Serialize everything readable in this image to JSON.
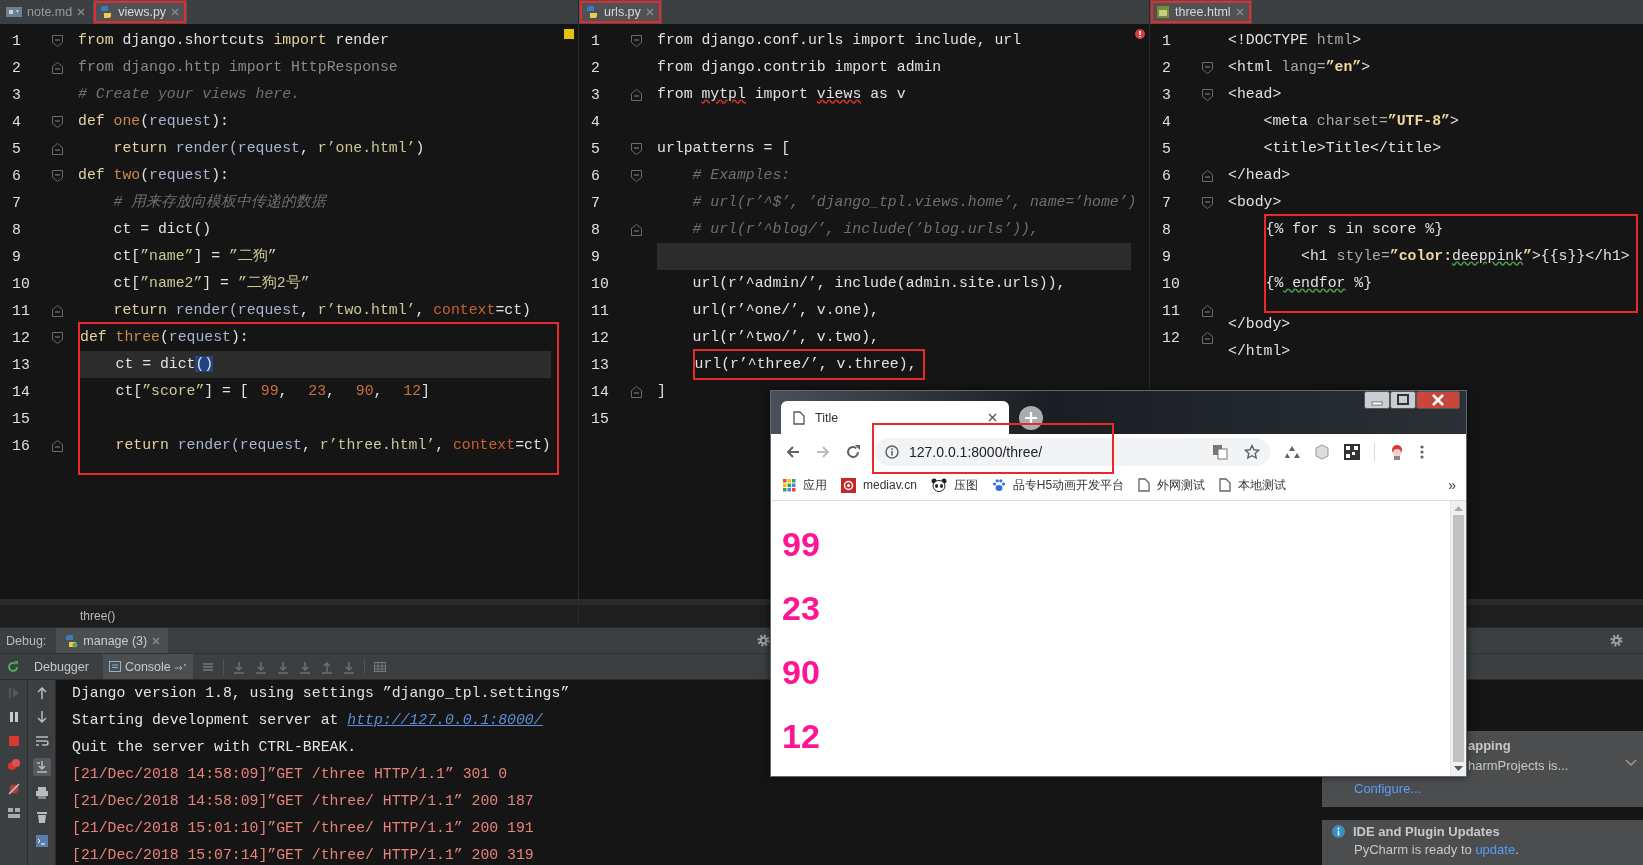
{
  "panes": [
    {
      "marker": {
        "kind": "warning"
      },
      "breadcrumb": "three()",
      "tabs": [
        {
          "label": "note.md",
          "kind": "md",
          "selected": false,
          "boxed": false
        },
        {
          "label": "views.py",
          "kind": "py",
          "selected": true,
          "boxed": true
        }
      ],
      "lines": [
        {
          "n": "1",
          "kind": "fold_start",
          "boxed": false,
          "current": false,
          "tokens": [
            {
              "kind": "kw",
              "text": "from"
            },
            {
              "kind": "txt",
              "text": " django.shortcuts "
            },
            {
              "kind": "kw",
              "text": "import"
            },
            {
              "kind": "txt",
              "text": " render"
            }
          ]
        },
        {
          "n": "2",
          "kind": "fold_end",
          "boxed": false,
          "current": false,
          "tokens": [
            {
              "kind": "dim",
              "text": "from django.http import HttpResponse"
            }
          ]
        },
        {
          "n": "3",
          "kind": "plain",
          "boxed": false,
          "current": false,
          "tokens": [
            {
              "kind": "com",
              "text": "# Create your views here."
            }
          ]
        },
        {
          "n": "4",
          "kind": "fold_start",
          "boxed": false,
          "current": false,
          "tokens": [
            {
              "kind": "kw",
              "text": "def"
            },
            {
              "kind": "name",
              "text": " one"
            },
            {
              "kind": "txt",
              "text": "("
            },
            {
              "kind": "param",
              "text": "request"
            },
            {
              "kind": "txt",
              "text": "):"
            }
          ]
        },
        {
          "n": "5",
          "kind": "fold_end",
          "boxed": false,
          "current": false,
          "tokens": [
            {
              "kind": "kw",
              "text": "    return"
            },
            {
              "kind": "param",
              "text": " render(request"
            },
            {
              "kind": "txt",
              "text": ", "
            },
            {
              "kind": "str",
              "text": "r’one.html’"
            },
            {
              "kind": "txt",
              "text": ")"
            }
          ]
        },
        {
          "n": "6",
          "kind": "fold_start",
          "boxed": false,
          "current": false,
          "tokens": [
            {
              "kind": "kw",
              "text": "def"
            },
            {
              "kind": "name",
              "text": " two"
            },
            {
              "kind": "txt",
              "text": "("
            },
            {
              "kind": "param",
              "text": "request"
            },
            {
              "kind": "txt",
              "text": "):"
            }
          ]
        },
        {
          "n": "7",
          "kind": "plain",
          "boxed": false,
          "current": false,
          "tokens": [
            {
              "kind": "com",
              "text": "    # 用来存放向模板中传递的数据"
            }
          ]
        },
        {
          "n": "8",
          "kind": "plain",
          "boxed": false,
          "current": false,
          "tokens": [
            {
              "kind": "txt",
              "text": "    ct = dict()"
            }
          ]
        },
        {
          "n": "9",
          "kind": "plain",
          "boxed": false,
          "current": false,
          "tokens": [
            {
              "kind": "txt",
              "text": "    ct["
            },
            {
              "kind": "str",
              "text": "”name”"
            },
            {
              "kind": "txt",
              "text": "] = "
            },
            {
              "kind": "str",
              "text": "”二狗”"
            }
          ]
        },
        {
          "n": "10",
          "kind": "plain",
          "boxed": false,
          "current": false,
          "tokens": [
            {
              "kind": "txt",
              "text": "    ct["
            },
            {
              "kind": "str",
              "text": "”name2”"
            },
            {
              "kind": "txt",
              "text": "] = "
            },
            {
              "kind": "str",
              "text": "”二狗2号”"
            }
          ]
        },
        {
          "n": "11",
          "kind": "fold_end",
          "boxed": false,
          "current": false,
          "tokens": [
            {
              "kind": "kw",
              "text": "    return"
            },
            {
              "kind": "param",
              "text": " render(request"
            },
            {
              "kind": "txt",
              "text": ", "
            },
            {
              "kind": "str",
              "text": "r’two.html’"
            },
            {
              "kind": "txt",
              "text": ", "
            },
            {
              "kind": "arg",
              "text": "context"
            },
            {
              "kind": "txt",
              "text": "=ct)"
            }
          ]
        },
        {
          "n": "12",
          "kind": "fold_start",
          "boxed": true,
          "current": false,
          "tokens": [
            {
              "kind": "kw",
              "text": "def"
            },
            {
              "kind": "name",
              "text": " three"
            },
            {
              "kind": "txt",
              "text": "("
            },
            {
              "kind": "param",
              "text": "request"
            },
            {
              "kind": "txt",
              "text": "):"
            }
          ]
        },
        {
          "n": "13",
          "kind": "plain",
          "boxed": true,
          "current": true,
          "tokens": [
            {
              "kind": "txt",
              "text": "    ct = dict"
            },
            {
              "kind": "sel",
              "text": "()"
            }
          ]
        },
        {
          "n": "14",
          "kind": "plain",
          "boxed": true,
          "current": false,
          "tokens": [
            {
              "kind": "txt",
              "text": "    ct["
            },
            {
              "kind": "str",
              "text": "”score”"
            },
            {
              "kind": "txt",
              "text": "] = ["
            },
            {
              "kind": "num",
              "text": "99"
            },
            {
              "kind": "txt",
              "text": ", "
            },
            {
              "kind": "num",
              "text": "23"
            },
            {
              "kind": "txt",
              "text": ", "
            },
            {
              "kind": "num",
              "text": "90"
            },
            {
              "kind": "txt",
              "text": ", "
            },
            {
              "kind": "num",
              "text": "12"
            },
            {
              "kind": "txt",
              "text": "]"
            }
          ]
        },
        {
          "n": "15",
          "kind": "plain",
          "boxed": true,
          "current": false
        },
        {
          "n": "16",
          "kind": "fold_end",
          "boxed": true,
          "current": false,
          "tokens": [
            {
              "kind": "kw",
              "text": "    return"
            },
            {
              "kind": "param",
              "text": " render(request"
            },
            {
              "kind": "txt",
              "text": ", "
            },
            {
              "kind": "str",
              "text": "r’three.html’"
            },
            {
              "kind": "txt",
              "text": ", "
            },
            {
              "kind": "arg",
              "text": "context"
            },
            {
              "kind": "txt",
              "text": "=ct)"
            }
          ]
        }
      ]
    },
    {
      "marker": {
        "kind": "error"
      },
      "tabs": [
        {
          "label": "urls.py",
          "kind": "py",
          "selected": true,
          "boxed": true
        }
      ],
      "lines": [
        {
          "n": "1",
          "kind": "fold_start",
          "boxed": false,
          "current": false,
          "tokens": [
            {
              "kind": "txt",
              "text": "from django.conf.urls import include, url"
            }
          ]
        },
        {
          "n": "2",
          "kind": "plain",
          "boxed": false,
          "current": false,
          "tokens": [
            {
              "kind": "txt",
              "text": "from django.contrib import admin"
            }
          ]
        },
        {
          "n": "3",
          "kind": "fold_end",
          "boxed": false,
          "current": false,
          "tokens": [
            {
              "kind": "txt",
              "text": "from "
            },
            {
              "kind": "typo",
              "text": "mytpl"
            },
            {
              "kind": "txt",
              "text": " import "
            },
            {
              "kind": "typo",
              "text": "views"
            },
            {
              "kind": "txt",
              "text": " as v"
            }
          ]
        },
        {
          "n": "4",
          "kind": "plain",
          "current": false
        },
        {
          "n": "5",
          "kind": "fold_start",
          "boxed": false,
          "current": false,
          "tokens": [
            {
              "kind": "txt",
              "text": "urlpatterns = ["
            }
          ]
        },
        {
          "n": "6",
          "kind": "fold_start",
          "boxed": false,
          "current": false,
          "tokens": [
            {
              "kind": "com",
              "text": "    # Examples:"
            }
          ]
        },
        {
          "n": "7",
          "kind": "plain",
          "boxed": false,
          "current": false,
          "tokens": [
            {
              "kind": "com",
              "text": "    # url(r’^$’, ’django_tpl.views.home’, name=’home’)"
            }
          ]
        },
        {
          "n": "8",
          "kind": "fold_end",
          "boxed": false,
          "current": false,
          "tokens": [
            {
              "kind": "com",
              "text": "    # url(r’^blog/’, include(’blog.urls’)),"
            }
          ]
        },
        {
          "n": "9",
          "kind": "plain",
          "boxed": false,
          "current": true
        },
        {
          "n": "10",
          "kind": "plain",
          "boxed": false,
          "current": false,
          "tokens": [
            {
              "kind": "txt",
              "text": "    url(r’^admin/’, include(admin.site.urls)),"
            }
          ]
        },
        {
          "n": "11",
          "kind": "plain",
          "boxed": false,
          "current": false,
          "tokens": [
            {
              "kind": "txt",
              "text": "    url(r’^one/’, v.one),"
            }
          ]
        },
        {
          "n": "12",
          "kind": "plain",
          "boxed": false,
          "current": false,
          "tokens": [
            {
              "kind": "txt",
              "text": "    url(r’^two/’, v.two),"
            }
          ]
        },
        {
          "n": "13",
          "kind": "plain",
          "boxed": true,
          "current": false,
          "tokens": [
            {
              "kind": "txt",
              "text": "    url(r’^three/’, v.three),"
            }
          ]
        },
        {
          "n": "14",
          "kind": "fold_end",
          "boxed": false,
          "current": false,
          "tokens": [
            {
              "kind": "txt",
              "text": "]"
            }
          ]
        },
        {
          "n": "15",
          "kind": "plain",
          "current": false
        }
      ]
    },
    {
      "tabs": [
        {
          "label": "three.html",
          "kind": "html",
          "selected": true,
          "boxed": true
        }
      ],
      "lines": [
        {
          "n": "1",
          "kind": "plain",
          "boxed": false,
          "current": false,
          "tokens": [
            {
              "kind": "tag",
              "text": "<!DOCTYPE"
            },
            {
              "kind": "attr",
              "text": " html"
            },
            {
              "kind": "tag",
              "text": ">"
            }
          ]
        },
        {
          "n": "2",
          "kind": "fold_start",
          "boxed": false,
          "current": false,
          "tokens": [
            {
              "kind": "tag",
              "text": "<html"
            },
            {
              "kind": "attr",
              "text": " lang="
            },
            {
              "kind": "val",
              "text": "”en”"
            },
            {
              "kind": "tag",
              "text": ">"
            }
          ]
        },
        {
          "n": "3",
          "kind": "fold_start",
          "boxed": false,
          "current": false,
          "tokens": [
            {
              "kind": "tag",
              "text": "<head>"
            }
          ]
        },
        {
          "n": "4",
          "kind": "plain",
          "boxed": false,
          "current": false,
          "tokens": [
            {
              "kind": "tag",
              "text": "    <meta"
            },
            {
              "kind": "attr",
              "text": " charset="
            },
            {
              "kind": "val",
              "text": "”UTF-8”"
            },
            {
              "kind": "tag",
              "text": ">"
            }
          ]
        },
        {
          "n": "5",
          "kind": "plain",
          "boxed": false,
          "current": false,
          "tokens": [
            {
              "kind": "tag",
              "text": "    <title>Title</title>"
            }
          ]
        },
        {
          "n": "6",
          "kind": "fold_end",
          "boxed": false,
          "current": false,
          "tokens": [
            {
              "kind": "tag",
              "text": "</head>"
            }
          ]
        },
        {
          "n": "7",
          "kind": "fold_start",
          "boxed": false,
          "current": false,
          "tokens": [
            {
              "kind": "tag",
              "text": "<body>"
            }
          ]
        },
        {
          "n": "8",
          "kind": "plain",
          "boxed": true,
          "current": false,
          "tokens": [
            {
              "kind": "tag",
              "text": "    {% for s in score %}"
            }
          ]
        },
        {
          "n": "9",
          "kind": "plain",
          "boxed": true,
          "current": false,
          "tokens": [
            {
              "kind": "tag",
              "text": "        <h1"
            },
            {
              "kind": "attr",
              "text": " style="
            },
            {
              "kind": "val",
              "text": "”color:"
            },
            {
              "kind": "spell",
              "text": "deeppink"
            },
            {
              "kind": "val",
              "text": "”"
            },
            {
              "kind": "tag",
              "text": ">{{s}}</h1>"
            }
          ]
        },
        {
          "n": "10",
          "kind": "plain",
          "boxed": true,
          "current": false,
          "tokens": [
            {
              "kind": "tag",
              "text": "    {%"
            },
            {
              "kind": "spell",
              "text": " endfor"
            },
            {
              "kind": "tag",
              "text": " %}"
            }
          ]
        },
        {
          "n": "11",
          "kind": "fold_end",
          "boxed": false,
          "current": false,
          "tokens": [
            {
              "kind": "tag",
              "text": "</body>"
            }
          ]
        },
        {
          "n": "12",
          "kind": "fold_end",
          "boxed": false,
          "current": false,
          "tokens": [
            {
              "kind": "tag",
              "text": "</html>"
            }
          ]
        }
      ]
    }
  ],
  "debug": {
    "label": "Debug:",
    "session": "manage (3)",
    "tabs": [
      {
        "label": "Debugger",
        "selected": false
      },
      {
        "label": "Console",
        "selected": true
      }
    ],
    "console": [
      {
        "kind": "out",
        "text": "Django version 1.8, using settings ”django_tpl.settings”"
      },
      {
        "kind": "out",
        "text": "Starting development server at ",
        "link": "http://127.0.0.1:8000/"
      },
      {
        "kind": "out",
        "text": "Quit the server with CTRL-BREAK."
      },
      {
        "kind": "err",
        "text": "[21/Dec/2018 14:58:09]”GET /three HTTP/1.1” 301 0"
      },
      {
        "kind": "err",
        "text": "[21/Dec/2018 14:58:09]”GET /three/ HTTP/1.1” 200 187"
      },
      {
        "kind": "err",
        "text": "[21/Dec/2018 15:01:10]”GET /three/ HTTP/1.1” 200 191"
      },
      {
        "kind": "err",
        "text": "[21/Dec/2018 15:07:14]”GET /three/ HTTP/1.1” 200 319"
      }
    ]
  },
  "notifications": [
    {
      "kind": "partial",
      "title": "apping",
      "body": "harmProjects is...",
      "link": "Configure..."
    },
    {
      "kind": "info",
      "title": "IDE and Plugin Updates",
      "body": "PyCharm is ready to ",
      "link": "update",
      "tail": "."
    }
  ],
  "browser": {
    "tab_title": "Title",
    "url": "127.0.0.1:8000/three/",
    "url_boxed": true,
    "bookmarks": [
      {
        "label": "应用",
        "kind": "apps"
      },
      {
        "label": "mediav.cn",
        "kind": "at"
      },
      {
        "label": "压图",
        "kind": "panda"
      },
      {
        "label": "品专H5动画开发平台",
        "kind": "paw"
      },
      {
        "label": "外网测试",
        "kind": "page"
      },
      {
        "label": "本地测试",
        "kind": "page"
      }
    ],
    "more": "»",
    "headings": [
      "99",
      "23",
      "90",
      "12"
    ]
  }
}
